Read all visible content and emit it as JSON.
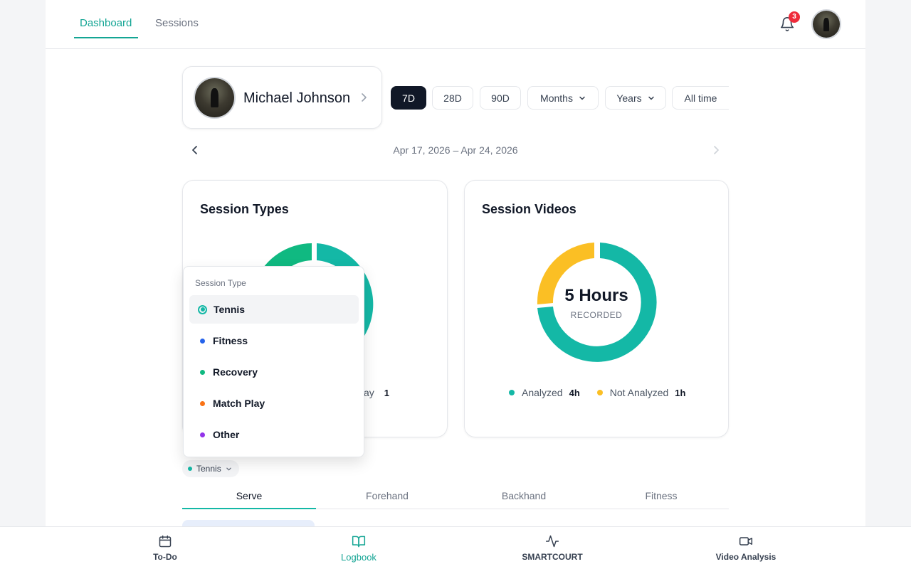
{
  "topnav": {
    "tabs": [
      {
        "label": "Dashboard",
        "active": true
      },
      {
        "label": "Sessions",
        "active": false
      }
    ],
    "notification_count": "3"
  },
  "profile": {
    "name": "Michael Johnson"
  },
  "ranges": [
    {
      "label": "7D",
      "active": true
    },
    {
      "label": "28D"
    },
    {
      "label": "90D"
    },
    {
      "label": "Months"
    },
    {
      "label": "Years"
    },
    {
      "label": "All time"
    }
  ],
  "date_range": "Apr 17, 2026 – Apr 24, 2026",
  "session_types": {
    "title": "Session Types",
    "legend_partial_label": "ay",
    "legend_partial_value": "1"
  },
  "session_videos": {
    "title": "Session Videos",
    "center_value": "5 Hours",
    "center_label": "RECORDED",
    "legend": [
      {
        "label": "Analyzed",
        "value": "4h",
        "color": "#14b8a6"
      },
      {
        "label": "Not Analyzed",
        "value": "1h",
        "color": "#fbbf24"
      }
    ]
  },
  "dropdown": {
    "header": "Session Type",
    "items": [
      {
        "label": "Tennis",
        "color": "#14b8a6",
        "selected": true
      },
      {
        "label": "Fitness",
        "color": "#2563eb"
      },
      {
        "label": "Recovery",
        "color": "#10b981"
      },
      {
        "label": "Match Play",
        "color": "#f97316"
      },
      {
        "label": "Other",
        "color": "#9333ea"
      }
    ]
  },
  "filter_chip": {
    "label": "Tennis",
    "color": "#14b8a6"
  },
  "stroke_tabs": [
    {
      "label": "Serve",
      "active": true
    },
    {
      "label": "Forehand"
    },
    {
      "label": "Backhand"
    },
    {
      "label": "Fitness"
    }
  ],
  "bottom_nav": [
    {
      "label": "To-Do",
      "icon": "calendar-icon"
    },
    {
      "label": "Logbook",
      "icon": "book-icon",
      "active": true
    },
    {
      "label": "SMARTCOURT",
      "icon": "activity-icon"
    },
    {
      "label": "Video Analysis",
      "icon": "video-icon"
    }
  ],
  "colors": {
    "accent": "#14a594",
    "teal": "#14b8a6",
    "green": "#10b981",
    "yellow": "#fbbf24",
    "dark": "#111827"
  }
}
